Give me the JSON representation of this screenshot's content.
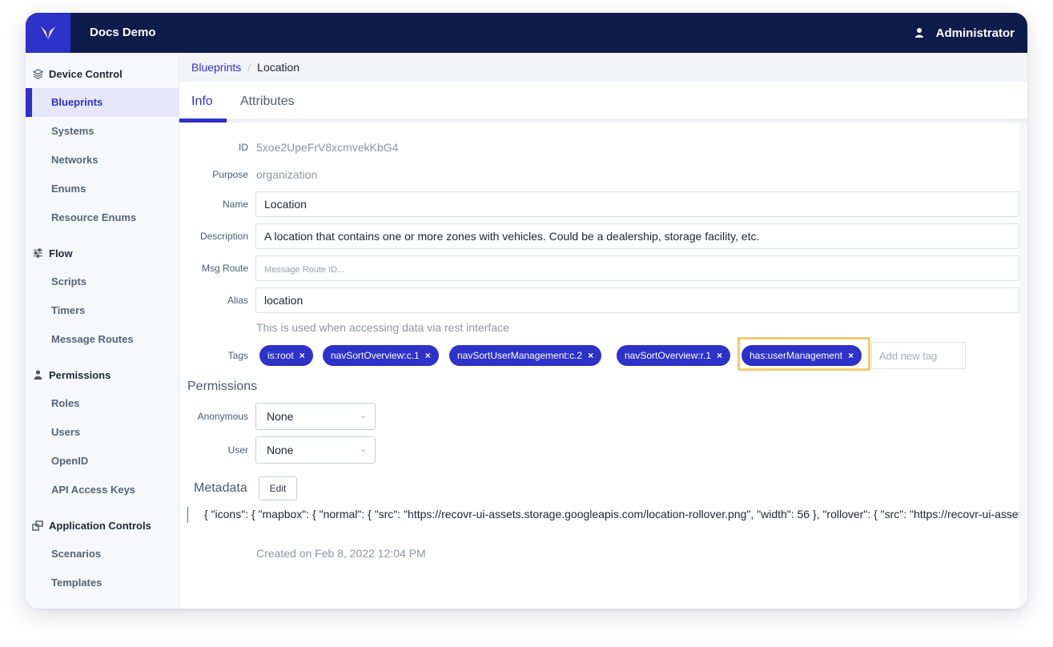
{
  "header": {
    "app_title": "Docs Demo",
    "user_name": "Administrator"
  },
  "sidebar": {
    "sections": [
      {
        "label": "Device Control",
        "icon": "layers-icon",
        "items": [
          {
            "label": "Blueprints",
            "active": true
          },
          {
            "label": "Systems"
          },
          {
            "label": "Networks"
          },
          {
            "label": "Enums"
          },
          {
            "label": "Resource Enums"
          }
        ]
      },
      {
        "label": "Flow",
        "icon": "sliders-icon",
        "items": [
          {
            "label": "Scripts"
          },
          {
            "label": "Timers"
          },
          {
            "label": "Message Routes"
          }
        ]
      },
      {
        "label": "Permissions",
        "icon": "user-icon",
        "items": [
          {
            "label": "Roles"
          },
          {
            "label": "Users"
          },
          {
            "label": "OpenID"
          },
          {
            "label": "API Access Keys"
          }
        ]
      },
      {
        "label": "Application Controls",
        "icon": "windows-icon",
        "items": [
          {
            "label": "Scenarios"
          },
          {
            "label": "Templates"
          }
        ]
      }
    ]
  },
  "breadcrumb": {
    "parent": "Blueprints",
    "separator": "/",
    "current": "Location"
  },
  "tabs": [
    {
      "label": "Info",
      "active": true
    },
    {
      "label": "Attributes",
      "active": false
    }
  ],
  "form": {
    "id_label": "ID",
    "id_value": "5xoe2UpeFrV8xcmvekKbG4",
    "purpose_label": "Purpose",
    "purpose_value": "organization",
    "name_label": "Name",
    "name_value": "Location",
    "description_label": "Description",
    "description_value": "A location that contains one or more zones with vehicles. Could be a dealership, storage facility, etc.",
    "msg_route_label": "Msg Route",
    "msg_route_value": "",
    "msg_route_placeholder": "Message Route ID...",
    "alias_label": "Alias",
    "alias_value": "location",
    "alias_hint": "This is used when accessing data via rest interface",
    "tags_label": "Tags",
    "tags": [
      "is:root",
      "navSortOverview:c.1",
      "navSortUserManagement:c.2",
      "navSortOverview:r.1",
      "has:userManagement"
    ],
    "tag_remove_glyph": "×",
    "add_tag_placeholder": "Add new tag"
  },
  "permissions": {
    "title": "Permissions",
    "anonymous_label": "Anonymous",
    "anonymous_value": "None",
    "user_label": "User",
    "user_value": "None"
  },
  "metadata": {
    "title": "Metadata",
    "edit_label": "Edit",
    "json_text": "{ \"icons\": { \"mapbox\": { \"normal\": { \"src\": \"https://recovr-ui-assets.storage.googleapis.com/location-rollover.png\", \"width\": 56 }, \"rollover\": { \"src\": \"https://recovr-ui-assets.storage.googleapis.com/location-rollover.png\""
  },
  "created_text": "Created on Feb 8, 2022 12:04 PM",
  "colors": {
    "brand": "#2d32c9",
    "header_bg": "#0f1b4b",
    "focus_outline": "#f1cb6f"
  }
}
